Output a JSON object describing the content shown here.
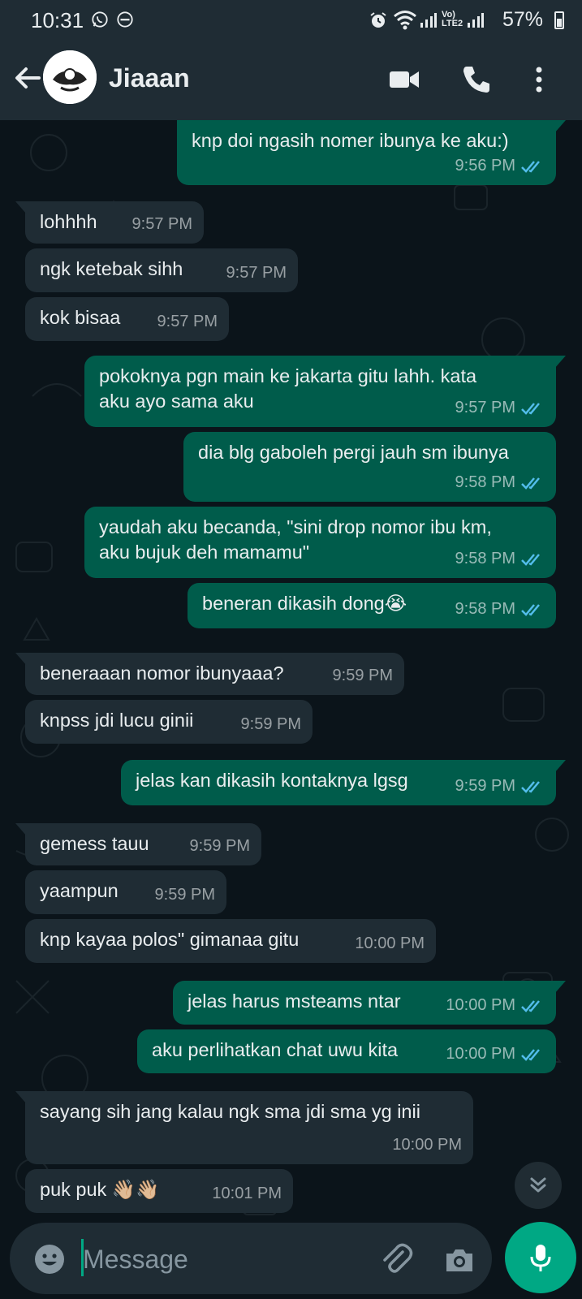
{
  "status_bar": {
    "time": "10:31",
    "network_label": "Vo) LTE2",
    "battery": "57%"
  },
  "header": {
    "contact_name": "Jiaaan",
    "icons": [
      "back-arrow-icon",
      "video-call-icon",
      "voice-call-icon",
      "more-options-icon"
    ]
  },
  "messages": [
    {
      "dir": "out",
      "text": "knp doi ngasih nomer ibunya ke aku:)",
      "time": "9:56 PM",
      "read": true
    },
    {
      "dir": "in",
      "text": "lohhhh",
      "time": "9:57 PM"
    },
    {
      "dir": "in",
      "text": "ngk ketebak sihh",
      "time": "9:57 PM"
    },
    {
      "dir": "in",
      "text": "kok bisaa",
      "time": "9:57 PM"
    },
    {
      "dir": "out",
      "text": "pokoknya pgn main ke jakarta gitu lahh. kata\naku ayo sama aku",
      "time": "9:57 PM",
      "read": true
    },
    {
      "dir": "out",
      "text": "dia blg gaboleh pergi jauh sm ibunya",
      "time": "9:58 PM",
      "read": true
    },
    {
      "dir": "out",
      "text": "yaudah aku becanda, \"sini drop nomor ibu km,\naku bujuk deh mamamu\"",
      "time": "9:58 PM",
      "read": true
    },
    {
      "dir": "out",
      "text": "beneran dikasih dong😭",
      "time": "9:58 PM",
      "read": true
    },
    {
      "dir": "in",
      "text": "beneraaan nomor ibunyaaa?",
      "time": "9:59 PM"
    },
    {
      "dir": "in",
      "text": "knpss jdi lucu ginii",
      "time": "9:59 PM"
    },
    {
      "dir": "out",
      "text": "jelas kan dikasih kontaknya lgsg",
      "time": "9:59 PM",
      "read": true
    },
    {
      "dir": "in",
      "text": "gemess tauu",
      "time": "9:59 PM"
    },
    {
      "dir": "in",
      "text": "yaampun",
      "time": "9:59 PM"
    },
    {
      "dir": "in",
      "text": "knp kayaa polos\" gimanaa gitu",
      "time": "10:00 PM"
    },
    {
      "dir": "out",
      "text": "jelas harus msteams ntar",
      "time": "10:00 PM",
      "read": true
    },
    {
      "dir": "out",
      "text": "aku perlihatkan chat uwu kita",
      "time": "10:00 PM",
      "read": true
    },
    {
      "dir": "in",
      "text": "sayang sih jang kalau ngk sma jdi sma yg inii",
      "time": "10:00 PM"
    },
    {
      "dir": "in",
      "text": "puk puk 👋🏼👋🏼",
      "time": "10:01 PM"
    }
  ],
  "input": {
    "placeholder": "Message"
  },
  "colors": {
    "outgoing_bubble": "#005c4b",
    "incoming_bubble": "#1f2c34",
    "accent": "#00a884",
    "read_ticks": "#53bdeb"
  }
}
